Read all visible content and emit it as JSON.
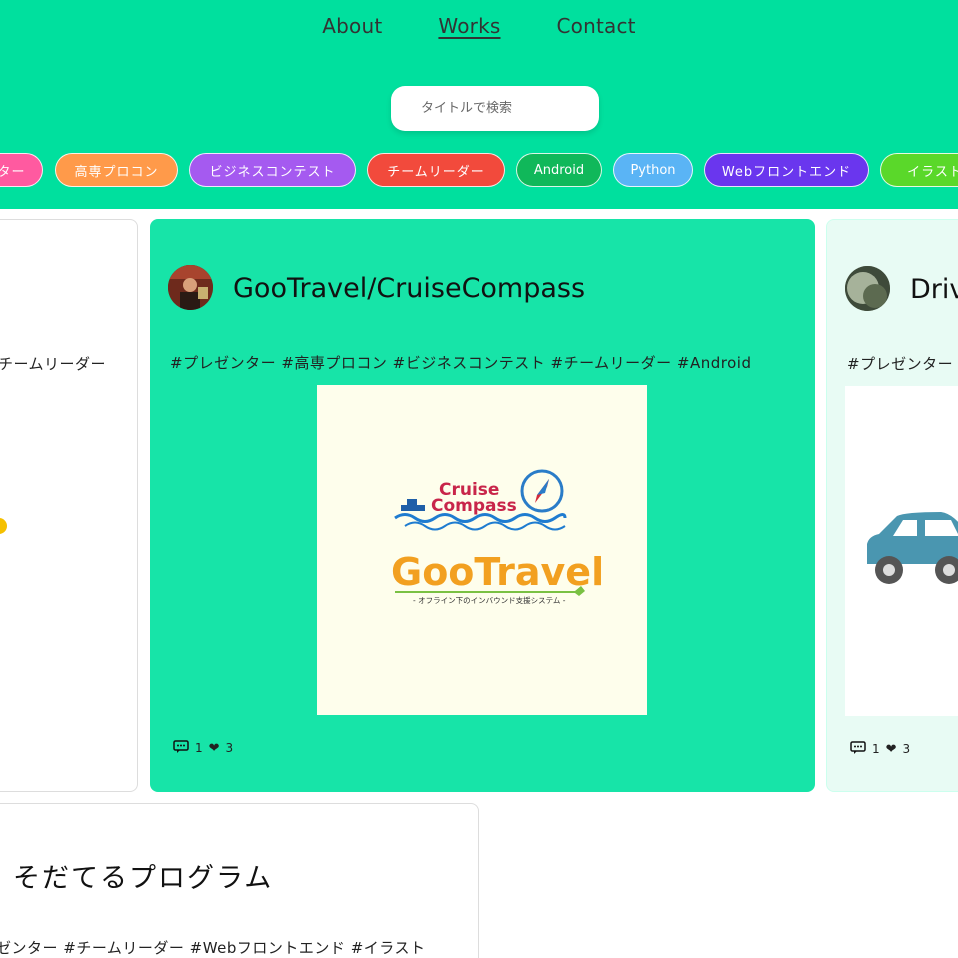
{
  "nav": {
    "items": [
      {
        "label": "About"
      },
      {
        "label": "Works"
      },
      {
        "label": "Contact"
      }
    ]
  },
  "search": {
    "placeholder": "タイトルで検索"
  },
  "tags": [
    {
      "label": "ター",
      "color": "#ff5aa0"
    },
    {
      "label": "高専プロコン",
      "color": "#ff9a4a"
    },
    {
      "label": "ビジネスコンテスト",
      "color": "#a55af0"
    },
    {
      "label": "チームリーダー",
      "color": "#f24a3c"
    },
    {
      "label": "Android",
      "color": "#10b85a"
    },
    {
      "label": "Python",
      "color": "#5ab4f5"
    },
    {
      "label": "Webフロントエンド",
      "color": "#6a36ee"
    },
    {
      "label": "イラスト",
      "color": "#5ad82a"
    }
  ],
  "cards": {
    "left": {
      "tags": "チームリーダー"
    },
    "main": {
      "title": "GooTravel/CruiseCompass",
      "tags": "#プレゼンター #高専プロコン #ビジネスコンテスト #チームリーダー #Android",
      "logo_top_1": "Cruise",
      "logo_top_2": "Compass",
      "logo_main": "GooTravel",
      "logo_sub": "- オフライン下のインバウンド支援システム -",
      "comments": "1",
      "likes": "3"
    },
    "right": {
      "title": "Driv",
      "tags": "#プレゼンター",
      "comments": "1",
      "likes": "3"
    },
    "bottom": {
      "title": "そだてるプログラム",
      "tags": "ゼンター #チームリーダー #Webフロントエンド #イラスト"
    }
  },
  "colors": {
    "header": "#00e09e",
    "card_active": "#17e4a8",
    "logo_bg": "#fefeec"
  }
}
